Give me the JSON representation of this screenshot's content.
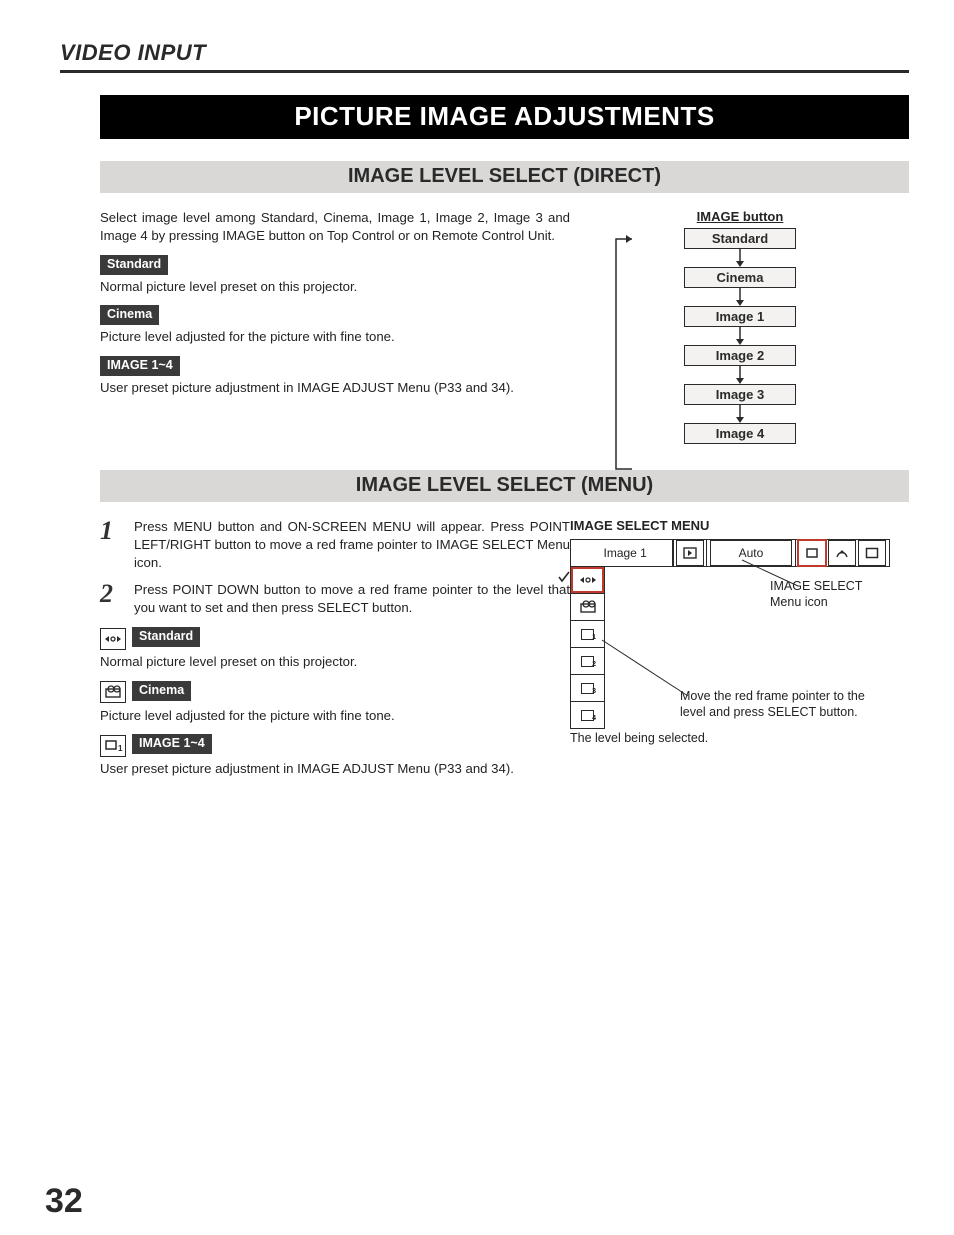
{
  "header": {
    "section": "VIDEO INPUT"
  },
  "banner": "PICTURE IMAGE ADJUSTMENTS",
  "sub1": "IMAGE LEVEL SELECT (DIRECT)",
  "sub2": "IMAGE LEVEL SELECT (MENU)",
  "intro": "Select image level among Standard, Cinema, Image 1, Image 2, Image 3 and Image 4 by pressing IMAGE button on Top Control or on Remote Control Unit.",
  "badges": {
    "standard": "Standard",
    "cinema": "Cinema",
    "image14": "IMAGE 1~4"
  },
  "desc": {
    "standard": "Normal picture level preset on this projector.",
    "cinema": "Picture level adjusted for the picture with fine tone.",
    "image14": "User preset picture adjustment in IMAGE ADJUST Menu (P33 and 34)."
  },
  "flow": {
    "title": "IMAGE button",
    "items": [
      "Standard",
      "Cinema",
      "Image 1",
      "Image 2",
      "Image 3",
      "Image 4"
    ]
  },
  "steps": {
    "s1": "Press MENU button and ON-SCREEN MENU will appear.  Press POINT LEFT/RIGHT button to move a red frame pointer to IMAGE SELECT Menu icon.",
    "s2": "Press POINT DOWN button to move a red frame pointer to the level that you want to set and then press SELECT button."
  },
  "menu": {
    "title": "IMAGE SELECT MENU",
    "selected": "Image 1",
    "mode": "Auto",
    "annot_icon": "IMAGE SELECT Menu icon",
    "annot_pointer": "Move the red frame pointer to the level and press SELECT button.",
    "caption": "The level being selected."
  },
  "page_number": "32"
}
